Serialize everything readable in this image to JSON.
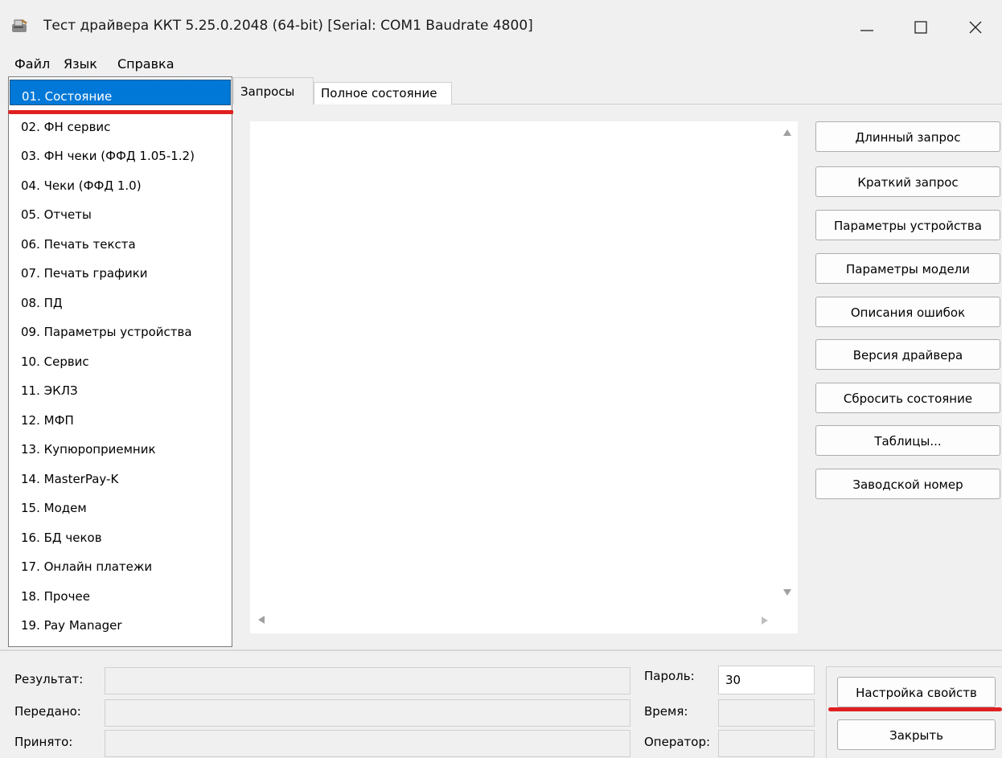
{
  "window": {
    "title": "Тест драйвера ККТ 5.25.0.2048 (64-bit) [Serial: COM1 Baudrate 4800]",
    "minimize_glyph": "—",
    "maximize_glyph": "☐",
    "close_glyph": "✕"
  },
  "menu": [
    "Файл",
    "Язык",
    "Справка"
  ],
  "sidebar": {
    "items": [
      "01. Состояние",
      "02. ФН сервис",
      "03. ФН чеки (ФФД 1.05-1.2)",
      "04. Чеки (ФФД 1.0)",
      "05. Отчеты",
      "06. Печать текста",
      "07. Печать графики",
      "08. ПД",
      "09. Параметры устройства",
      "10. Сервис",
      "11. ЭКЛЗ",
      "12. МФП",
      "13. Купюроприемник",
      "14. MasterPay-K",
      "15. Модем",
      "16. БД чеков",
      "17. Онлайн платежи",
      "18. Прочее",
      "19. Pay Manager"
    ],
    "selected_index": 0
  },
  "tabs": [
    "Запросы",
    "Полное состояние"
  ],
  "actions": [
    "Длинный запрос",
    "Краткий запрос",
    "Параметры устройства",
    "Параметры модели",
    "Описания ошибок",
    "Версия драйвера",
    "Сбросить состояние",
    "Таблицы...",
    "Заводской номер"
  ],
  "status": {
    "result_label": "Результат:",
    "sent_label": "Передано:",
    "received_label": "Принято:",
    "password_label": "Пароль:",
    "password_value": "30",
    "time_label": "Время:",
    "operator_label": "Оператор:"
  },
  "bottom_buttons": {
    "settings": "Настройка свойств",
    "close": "Закрыть"
  },
  "colors": {
    "selection": "#0078d7",
    "annotation": "#e02020",
    "window_bg": "#f0f0f0"
  }
}
